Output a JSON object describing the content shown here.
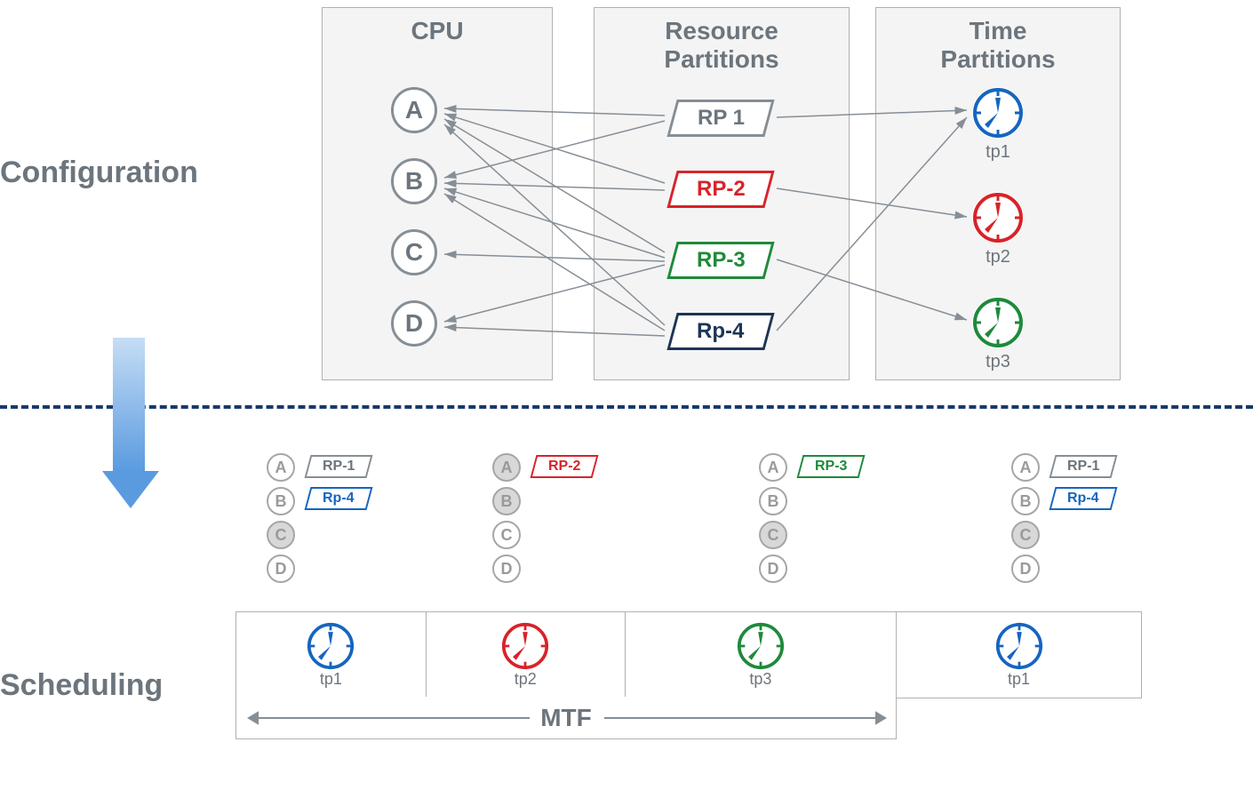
{
  "labels": {
    "configuration": "Configuration",
    "scheduling": "Scheduling",
    "mtf": "MTF"
  },
  "panels": {
    "cpu": {
      "title": "CPU"
    },
    "rp": {
      "title": "Resource\nPartitions"
    },
    "tp": {
      "title": "Time\nPartitions"
    }
  },
  "cpus": [
    "A",
    "B",
    "C",
    "D"
  ],
  "resource_partitions": [
    {
      "id": "RP 1",
      "color": "#868e96"
    },
    {
      "id": "RP-2",
      "color": "#d8232a"
    },
    {
      "id": "RP-3",
      "color": "#1e8a3b"
    },
    {
      "id": "Rp-4",
      "color": "#1d3557"
    }
  ],
  "time_partitions": [
    {
      "id": "tp1",
      "color": "#1565c0"
    },
    {
      "id": "tp2",
      "color": "#d8232a"
    },
    {
      "id": "tp3",
      "color": "#1e8a3b"
    }
  ],
  "config_links_rp_to_cpu": [
    {
      "rp": "RP 1",
      "cpus": [
        "A",
        "B"
      ]
    },
    {
      "rp": "RP-2",
      "cpus": [
        "A",
        "B"
      ]
    },
    {
      "rp": "RP-3",
      "cpus": [
        "A",
        "B",
        "C",
        "D"
      ]
    },
    {
      "rp": "Rp-4",
      "cpus": [
        "A",
        "B",
        "D"
      ]
    }
  ],
  "config_links_rp_to_tp": [
    {
      "rp": "RP 1",
      "tp": "tp1"
    },
    {
      "rp": "RP-2",
      "tp": "tp2"
    },
    {
      "rp": "RP-3",
      "tp": "tp3"
    },
    {
      "rp": "Rp-4",
      "tp": "tp1"
    }
  ],
  "scheduling": {
    "slots": [
      {
        "tp": "tp1",
        "tp_color": "#1565c0",
        "active_cpus": [
          "A",
          "B"
        ],
        "inactive_cpus": [
          "C",
          "D"
        ],
        "rps": [
          {
            "id": "RP-1",
            "color": "#868e96"
          },
          {
            "id": "Rp-4",
            "color": "#1565c0"
          }
        ]
      },
      {
        "tp": "tp2",
        "tp_color": "#d8232a",
        "active_cpus": [
          "C",
          "D"
        ],
        "inactive_cpus": [
          "A",
          "B"
        ],
        "filled_cpus": [
          "A",
          "B"
        ],
        "rps": [
          {
            "id": "RP-2",
            "color": "#d8232a"
          }
        ]
      },
      {
        "tp": "tp3",
        "tp_color": "#1e8a3b",
        "active_cpus": [
          "A",
          "B",
          "D"
        ],
        "inactive_cpus": [
          "C"
        ],
        "filled_cpus": [
          "C"
        ],
        "rps": [
          {
            "id": "RP-3",
            "color": "#1e8a3b"
          }
        ]
      },
      {
        "tp": "tp1",
        "tp_color": "#1565c0",
        "active_cpus": [
          "A",
          "B"
        ],
        "inactive_cpus": [
          "C",
          "D"
        ],
        "filled_cpus": [
          "C"
        ],
        "rps": [
          {
            "id": "RP-1",
            "color": "#868e96"
          },
          {
            "id": "Rp-4",
            "color": "#1565c0"
          }
        ]
      }
    ],
    "cell_widths_pct": [
      21,
      22,
      30,
      27
    ]
  },
  "colors": {
    "panel_border": "#b0b0b0",
    "arrow": "#868e96"
  }
}
